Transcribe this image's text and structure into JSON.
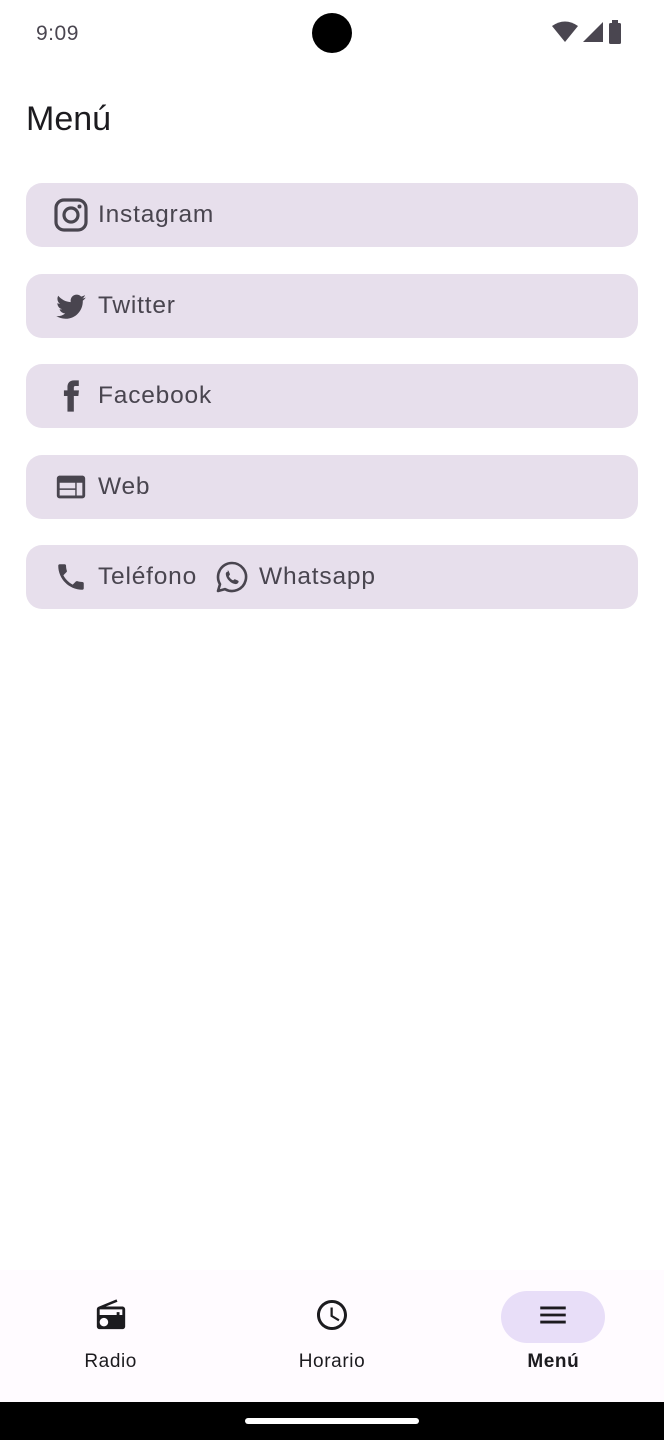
{
  "status_bar": {
    "time": "9:09",
    "icons": [
      "wifi-icon",
      "signal-icon",
      "battery-icon"
    ]
  },
  "page": {
    "title": "Menú"
  },
  "menu": {
    "items": [
      {
        "parts": [
          {
            "icon": "instagram-icon",
            "label": "Instagram"
          }
        ]
      },
      {
        "parts": [
          {
            "icon": "twitter-icon",
            "label": "Twitter"
          }
        ]
      },
      {
        "parts": [
          {
            "icon": "facebook-icon",
            "label": "Facebook"
          }
        ]
      },
      {
        "parts": [
          {
            "icon": "web-icon",
            "label": "Web"
          }
        ]
      },
      {
        "parts": [
          {
            "icon": "phone-icon",
            "label": "Teléfono"
          },
          {
            "icon": "whatsapp-icon",
            "label": "Whatsapp"
          }
        ]
      }
    ]
  },
  "bottom_nav": {
    "items": [
      {
        "icon": "radio-icon",
        "label": "Radio",
        "active": false
      },
      {
        "icon": "clock-icon",
        "label": "Horario",
        "active": false
      },
      {
        "icon": "menu-icon",
        "label": "Menú",
        "active": true
      }
    ]
  },
  "colors": {
    "item_background": "#e7dfec",
    "item_text": "#49454f",
    "active_indicator": "#e8def8"
  }
}
